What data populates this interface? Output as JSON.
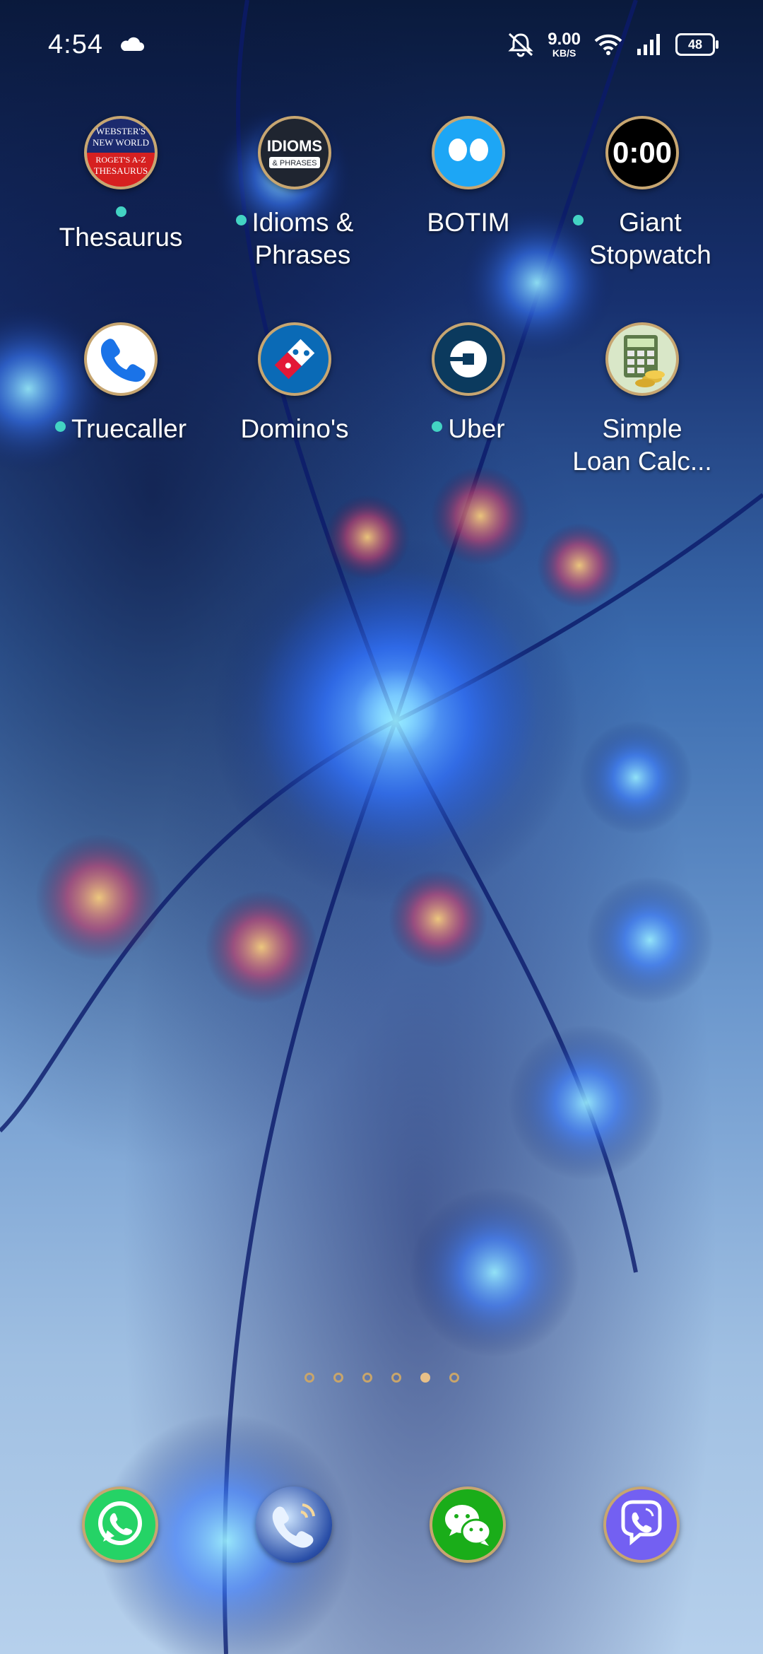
{
  "status_bar": {
    "time": "4:54",
    "net_speed_value": "9.00",
    "net_speed_unit": "KB/S",
    "battery": "48",
    "icons": [
      "cloud-icon",
      "mute-bell-icon",
      "wifi-icon",
      "signal-icon",
      "battery-icon"
    ]
  },
  "apps": [
    {
      "label": "Thesaurus",
      "dot": true,
      "icon": "thesaurus-book-icon",
      "icon_text": [
        "WEBSTER'S",
        "NEW WORLD",
        "ROGET'S A-Z",
        "THESAURUS"
      ]
    },
    {
      "label": "Idioms &\nPhrases",
      "dot": true,
      "icon": "idioms-icon",
      "icon_text": [
        "IDIOMS",
        "& PHRASES"
      ]
    },
    {
      "label": "BOTIM",
      "dot": false,
      "icon": "botim-icon"
    },
    {
      "label": "Giant\nStopwatch",
      "dot": true,
      "icon": "stopwatch-icon",
      "icon_text": [
        "0:00"
      ]
    },
    {
      "label": "Truecaller",
      "dot": true,
      "icon": "phone-icon"
    },
    {
      "label": "Domino's",
      "dot": false,
      "icon": "dominos-icon"
    },
    {
      "label": "Uber",
      "dot": true,
      "icon": "uber-icon"
    },
    {
      "label": "Simple\nLoan Calc...",
      "dot": false,
      "icon": "calculator-icon"
    }
  ],
  "pager": {
    "count": 6,
    "active_index": 4
  },
  "dock": [
    {
      "name": "whatsapp-icon"
    },
    {
      "name": "phone-dialer-icon"
    },
    {
      "name": "wechat-icon"
    },
    {
      "name": "viber-icon"
    }
  ],
  "colors": {
    "dot": "#43d3c3",
    "icon_ring": "#c7a671",
    "pager_active": "#e8c088"
  }
}
